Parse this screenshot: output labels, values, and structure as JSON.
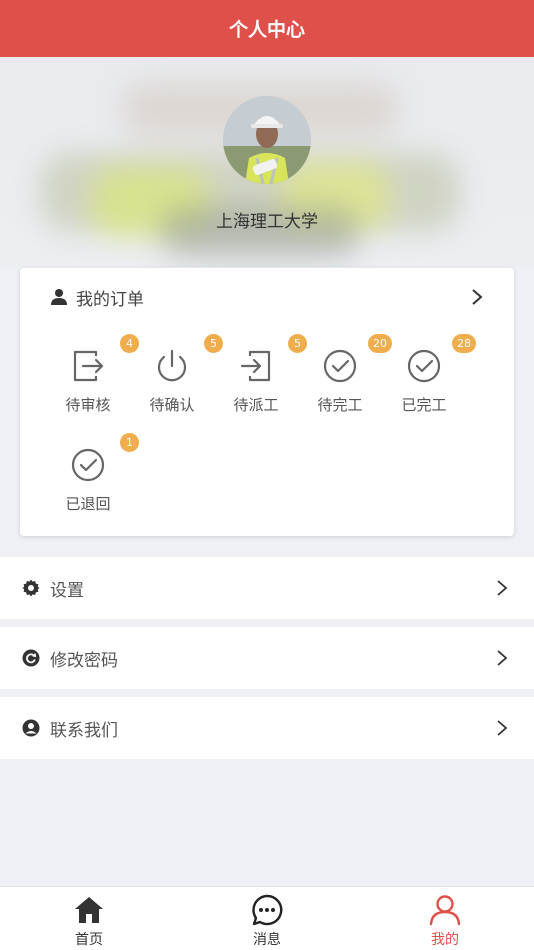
{
  "header": {
    "title": "个人中心"
  },
  "profile": {
    "username": "上海理工大学"
  },
  "orders": {
    "title": "我的订单",
    "items": [
      {
        "label": "待审核",
        "count": "4",
        "icon": "exit-square-icon"
      },
      {
        "label": "待确认",
        "count": "5",
        "icon": "power-icon"
      },
      {
        "label": "待派工",
        "count": "5",
        "icon": "enter-square-icon"
      },
      {
        "label": "待完工",
        "count": "20",
        "icon": "check-circle-icon"
      },
      {
        "label": "已完工",
        "count": "28",
        "icon": "check-circle-icon"
      },
      {
        "label": "已退回",
        "count": "1",
        "icon": "check-circle-icon"
      }
    ]
  },
  "menu": [
    {
      "label": "设置",
      "icon": "gear-icon"
    },
    {
      "label": "修改密码",
      "icon": "refresh-circle-icon"
    },
    {
      "label": "联系我们",
      "icon": "user-circle-icon"
    }
  ],
  "tabbar": [
    {
      "label": "首页",
      "icon": "home-icon",
      "active": false
    },
    {
      "label": "消息",
      "icon": "chat-icon",
      "active": false
    },
    {
      "label": "我的",
      "icon": "user-icon",
      "active": true
    }
  ],
  "colors": {
    "primary": "#e0504a",
    "badge": "#f0ad4e",
    "icon_gray": "#666666"
  }
}
